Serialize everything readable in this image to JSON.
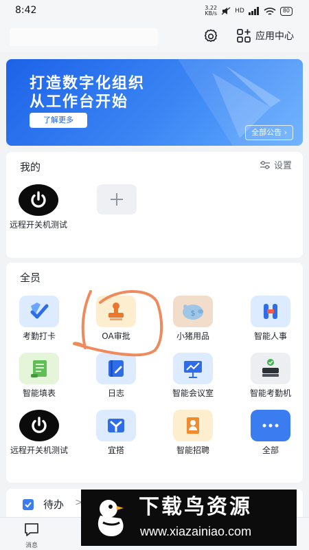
{
  "status_bar": {
    "time": "8:42",
    "net_speed_value": "3.22",
    "net_speed_unit": "KB/s",
    "network": "HD",
    "battery": "80"
  },
  "header": {
    "settings_icon": "gear-icon",
    "app_center_icon": "app-grid-icon",
    "app_center_label": "应用中心"
  },
  "banner": {
    "title_line1": "打造数字化组织",
    "title_line2": "从工作台开始",
    "learn_more": "了解更多",
    "all_notices": "全部公告 ›"
  },
  "mine": {
    "title": "我的",
    "settings_label": "设置",
    "apps": [
      {
        "label": "远程开关机测试",
        "icon": "power-icon"
      }
    ],
    "add_icon": "plus-icon"
  },
  "all_members": {
    "title": "全员",
    "apps": [
      {
        "label": "考勤打卡",
        "icon": "check-shield-icon"
      },
      {
        "label": "OA审批",
        "icon": "stamp-icon"
      },
      {
        "label": "小猪用品",
        "icon": "piggy-bank-icon"
      },
      {
        "label": "智能人事",
        "icon": "hr-icon"
      },
      {
        "label": "智能填表",
        "icon": "form-scroll-icon"
      },
      {
        "label": "日志",
        "icon": "journal-edit-icon"
      },
      {
        "label": "智能会议室",
        "icon": "meeting-screen-icon"
      },
      {
        "label": "智能考勤机",
        "icon": "attendance-machine-icon"
      },
      {
        "label": "远程开关机测试",
        "icon": "power-icon"
      },
      {
        "label": "宜搭",
        "icon": "yida-icon"
      },
      {
        "label": "智能招聘",
        "icon": "recruit-icon"
      },
      {
        "label": "全部",
        "icon": "more-dots-icon"
      }
    ]
  },
  "todo": {
    "label": "待办",
    "arrow": ">"
  },
  "tabbar": {
    "messages_label": "消息",
    "messages_icon": "chat-bubble-icon"
  },
  "watermark": {
    "title": "下载鸟资源",
    "url": "www.xiazainiao.com"
  },
  "colors": {
    "brand_blue": "#3b7cf0",
    "annotation_orange": "#ee8a5c"
  }
}
